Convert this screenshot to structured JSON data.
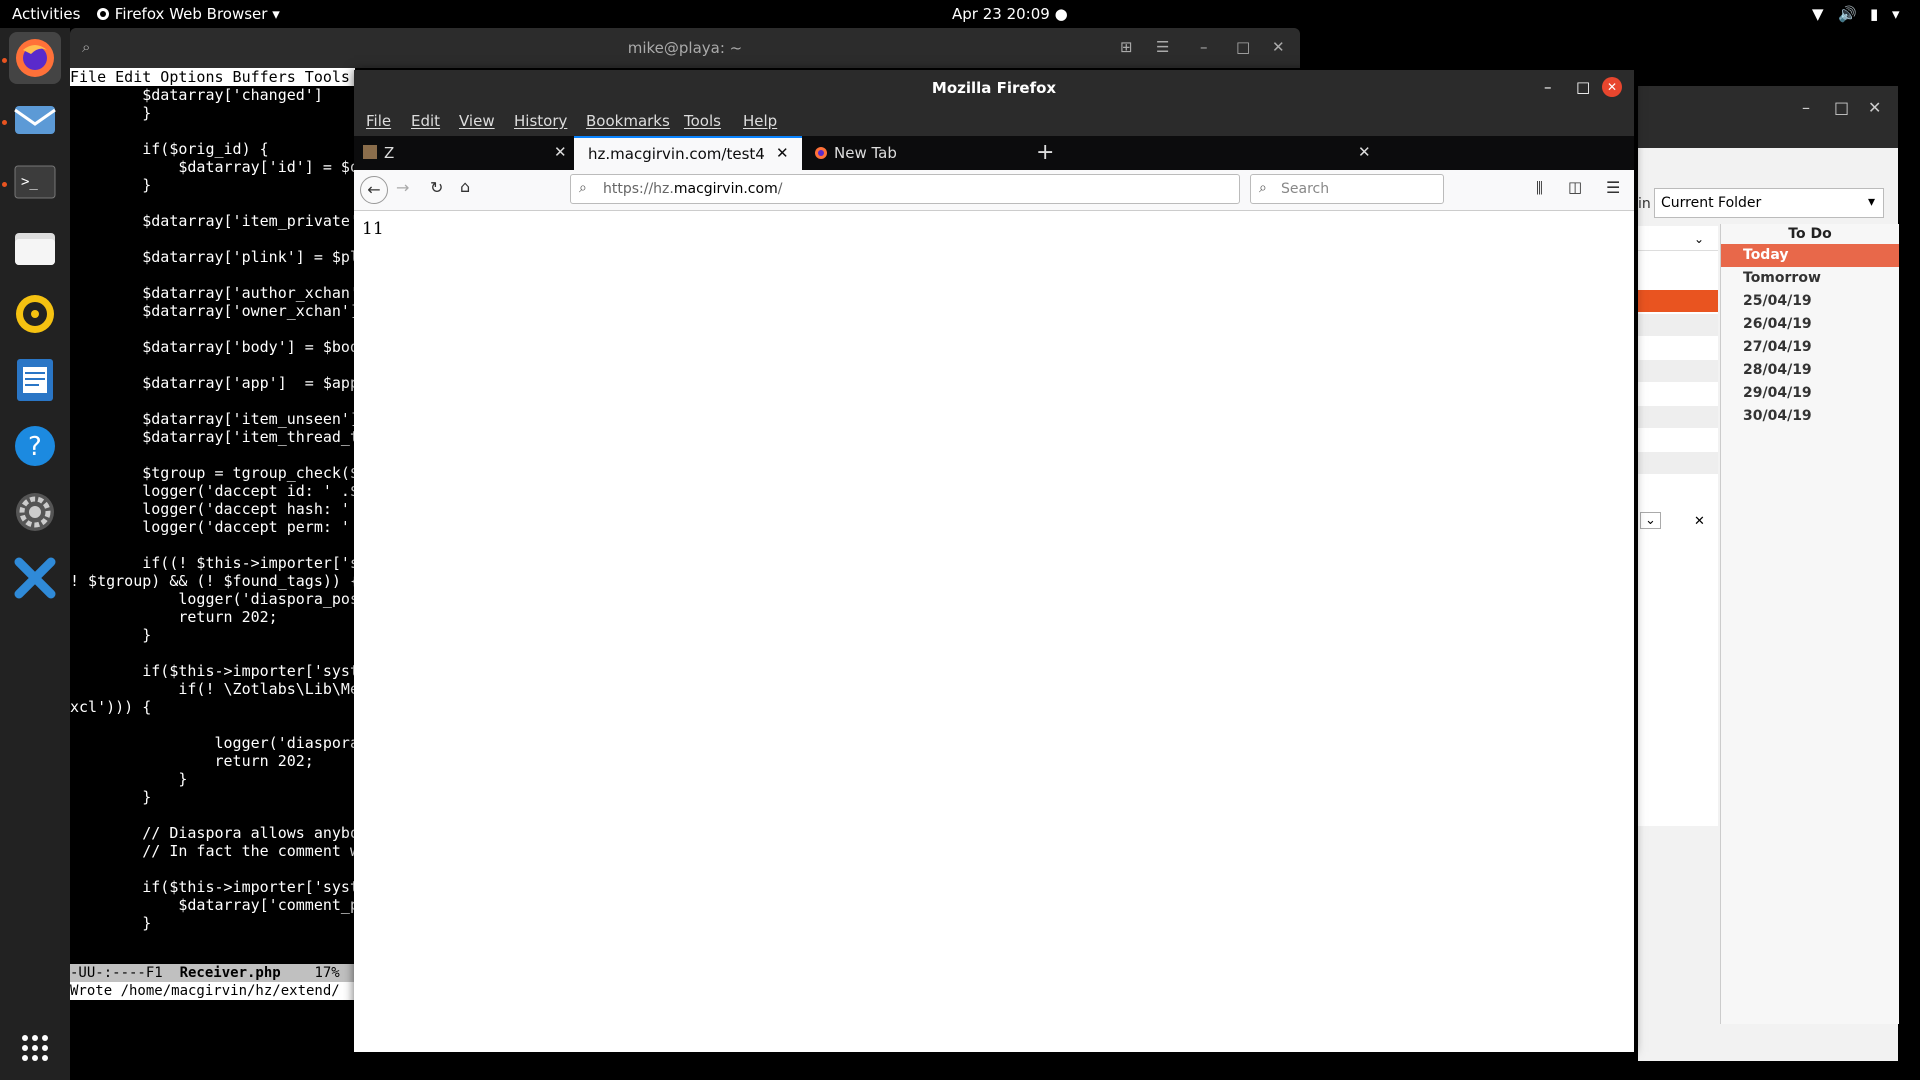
{
  "topbar": {
    "activities": "Activities",
    "app_menu": "Firefox Web Browser",
    "clock": "Apr 23  20:09"
  },
  "terminal": {
    "title": "mike@playa: ~",
    "menubar": "File Edit Options Buffers Tools",
    "code_lines": [
      "        $datarray['changed']",
      "        }",
      "",
      "        if($orig_id) {",
      "            $datarray['id'] = $o",
      "        }",
      "",
      "        $datarray['item_private'",
      "",
      "        $datarray['plink'] = $pl",
      "",
      "        $datarray['author_xchan'",
      "        $datarray['owner_xchan']",
      "",
      "        $datarray['body'] = $bod",
      "",
      "        $datarray['app']  = $app",
      "",
      "        $datarray['item_unseen']",
      "        $datarray['item_thread_t",
      "",
      "        $tgroup = tgroup_check($",
      "        logger('daccept id: ' .$",
      "        logger('daccept hash: '",
      "        logger('daccept perm: '",
      "",
      "        if((! $this->importer['s",
      "! $tgroup) && (! $found_tags)) {",
      "            logger('diaspora_pos",
      "            return 202;",
      "        }",
      "",
      "        if($this->importer['syst",
      "            if(! \\Zotlabs\\Lib\\Me",
      "xcl'))) {",
      "",
      "                logger('diaspora",
      "                return 202;",
      "            }",
      "        }",
      "",
      "        // Diaspora allows anybo",
      "        // In fact the comment w",
      "",
      "        if($this->importer['syst",
      "            $datarray['comment_p",
      "        }"
    ],
    "modeline_prefix": "-UU-:----F1  ",
    "modeline_file": "Receiver.php",
    "modeline_suffix": "    17%",
    "echo": "Wrote /home/macgirvin/hz/extend/"
  },
  "thunderbird": {
    "search_in_label": "in",
    "folder_select": "Current Folder",
    "todo_header": "To Do",
    "todo_items": [
      "Today",
      "Tomorrow",
      "25/04/19",
      "26/04/19",
      "27/04/19",
      "28/04/19",
      "29/04/19",
      "30/04/19"
    ]
  },
  "firefox": {
    "title": "Mozilla Firefox",
    "menu": [
      "File",
      "Edit",
      "View",
      "History",
      "Bookmarks",
      "Tools",
      "Help"
    ],
    "tabs": [
      {
        "label": "Z"
      },
      {
        "label": "hz.macgirvin.com/test4"
      },
      {
        "label": "New Tab"
      }
    ],
    "url_prefix": "https://hz.",
    "url_domain": "macgirvin.com",
    "url_suffix": "/",
    "search_placeholder": "Search",
    "page_text": "11"
  },
  "colors": {
    "ubuntu_orange": "#e95420",
    "firefox_blue": "#0a84ff",
    "close_red": "#e8462e"
  }
}
